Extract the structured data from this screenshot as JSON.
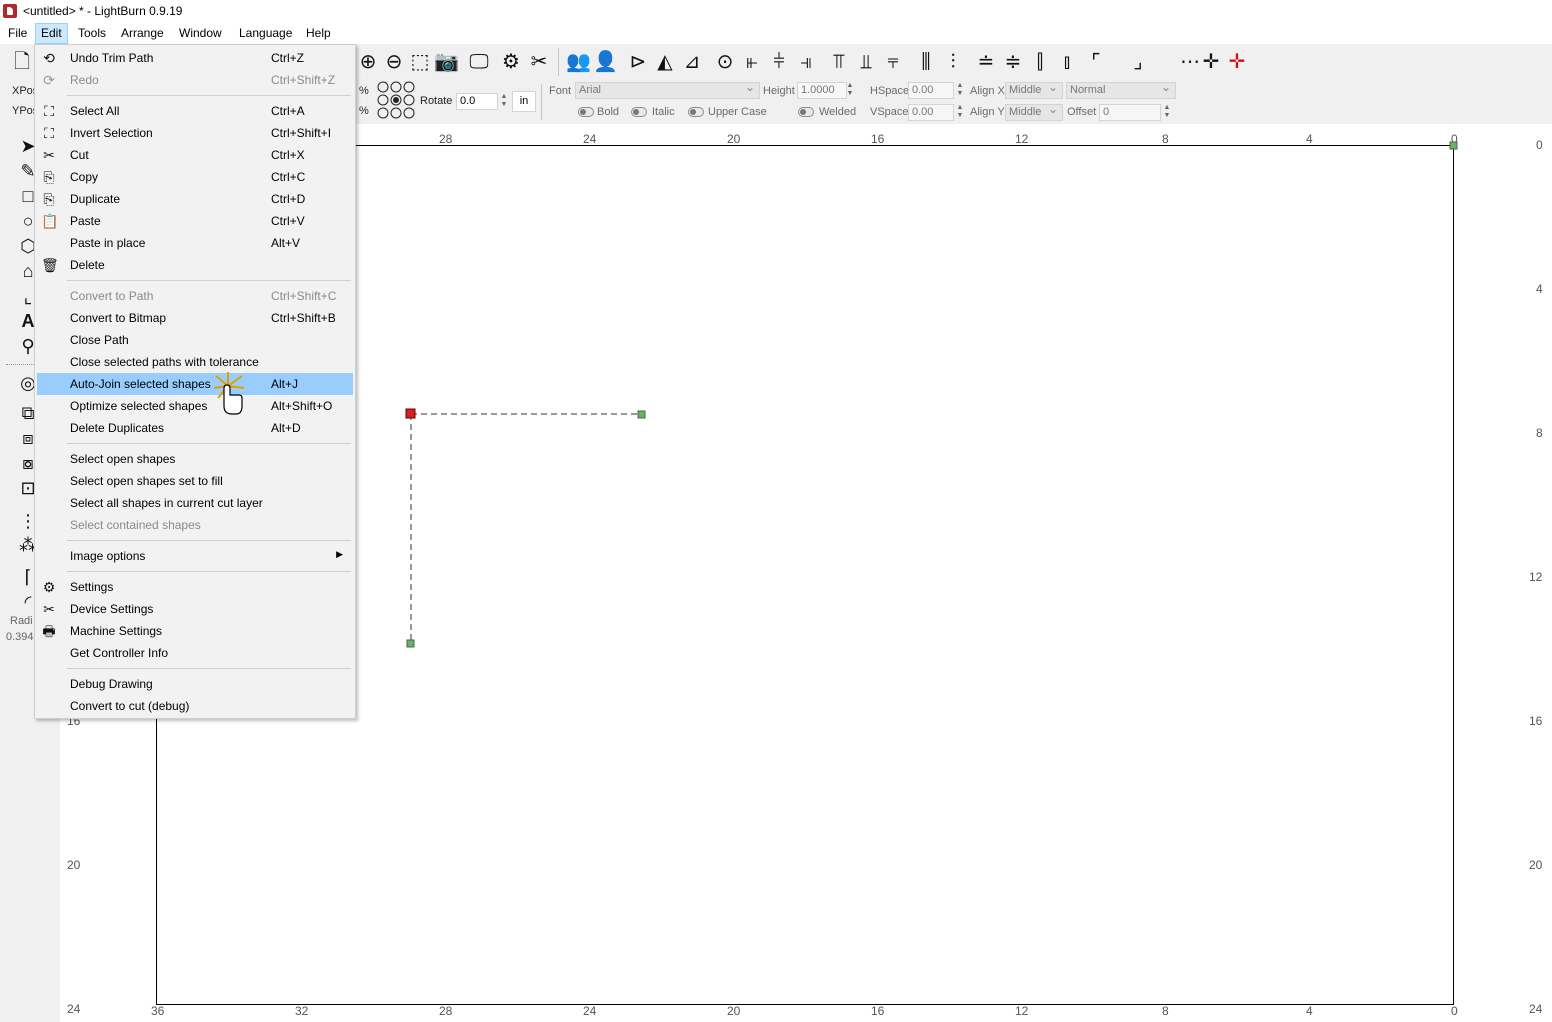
{
  "window": {
    "title": "<untitled> * - LightBurn 0.9.19"
  },
  "menubar": [
    "File",
    "Edit",
    "Tools",
    "Arrange",
    "Window",
    "Language",
    "Help"
  ],
  "edit_menu": {
    "items": [
      {
        "label": "Undo Trim Path",
        "shortcut": "Ctrl+Z",
        "icon": "undo-icon",
        "enabled": true
      },
      {
        "label": "Redo",
        "shortcut": "Ctrl+Shift+Z",
        "icon": "redo-icon",
        "enabled": false
      },
      {
        "label": "Select All",
        "shortcut": "Ctrl+A",
        "icon": "select-all-icon",
        "enabled": true
      },
      {
        "label": "Invert Selection",
        "shortcut": "Ctrl+Shift+I",
        "icon": "invert-selection-icon",
        "enabled": true
      },
      {
        "label": "Cut",
        "shortcut": "Ctrl+X",
        "icon": "scissors-icon",
        "enabled": true
      },
      {
        "label": "Copy",
        "shortcut": "Ctrl+C",
        "icon": "copy-icon",
        "enabled": true
      },
      {
        "label": "Duplicate",
        "shortcut": "Ctrl+D",
        "icon": "duplicate-icon",
        "enabled": true
      },
      {
        "label": "Paste",
        "shortcut": "Ctrl+V",
        "icon": "paste-icon",
        "enabled": true
      },
      {
        "label": "Paste in place",
        "shortcut": "Alt+V",
        "icon": "",
        "enabled": true
      },
      {
        "label": "Delete",
        "shortcut": "",
        "icon": "trash-icon",
        "enabled": true
      },
      {
        "label": "Convert to Path",
        "shortcut": "Ctrl+Shift+C",
        "icon": "",
        "enabled": false
      },
      {
        "label": "Convert to Bitmap",
        "shortcut": "Ctrl+Shift+B",
        "icon": "",
        "enabled": true
      },
      {
        "label": "Close Path",
        "shortcut": "",
        "icon": "",
        "enabled": true
      },
      {
        "label": "Close selected paths with tolerance",
        "shortcut": "",
        "icon": "",
        "enabled": true
      },
      {
        "label": "Auto-Join selected shapes",
        "shortcut": "Alt+J",
        "icon": "",
        "enabled": true,
        "highlighted": true
      },
      {
        "label": "Optimize selected shapes",
        "shortcut": "Alt+Shift+O",
        "icon": "",
        "enabled": true
      },
      {
        "label": "Delete Duplicates",
        "shortcut": "Alt+D",
        "icon": "",
        "enabled": true
      },
      {
        "label": "Select open shapes",
        "shortcut": "",
        "icon": "",
        "enabled": true
      },
      {
        "label": "Select open shapes set to fill",
        "shortcut": "",
        "icon": "",
        "enabled": true
      },
      {
        "label": "Select all shapes in current cut layer",
        "shortcut": "",
        "icon": "",
        "enabled": true
      },
      {
        "label": "Select contained shapes",
        "shortcut": "",
        "icon": "",
        "enabled": false
      },
      {
        "label": "Image options",
        "shortcut": "",
        "icon": "",
        "enabled": true,
        "submenu": true
      },
      {
        "label": "Settings",
        "shortcut": "",
        "icon": "gears-icon",
        "enabled": true
      },
      {
        "label": "Device Settings",
        "shortcut": "",
        "icon": "wrench-icon",
        "enabled": true
      },
      {
        "label": "Machine Settings",
        "shortcut": "",
        "icon": "machine-icon",
        "enabled": true
      },
      {
        "label": "Get Controller Info",
        "shortcut": "",
        "icon": "",
        "enabled": true
      },
      {
        "label": "Debug Drawing",
        "shortcut": "",
        "icon": "",
        "enabled": true
      },
      {
        "label": "Convert to cut (debug)",
        "shortcut": "",
        "icon": "",
        "enabled": true
      }
    ]
  },
  "props": {
    "xpos_label": "XPos",
    "ypos_label": "YPos",
    "pct1": "%",
    "pct2": "%",
    "rotate_label": "Rotate",
    "rotate_value": "0.0",
    "unit": "in",
    "font_label": "Font",
    "font_value": "Arial",
    "height_label": "Height",
    "height_value": "1.0000",
    "hspace_label": "HSpace",
    "hspace_value": "0.00",
    "vspace_label": "VSpace",
    "vspace_value": "0.00",
    "alignx_label": "Align X",
    "alignx_value": "Middle",
    "aligny_label": "Align Y",
    "aligny_value": "Middle",
    "style_value": "Normal",
    "offset_label": "Offset",
    "offset_value": "0",
    "bold_label": "Bold",
    "italic_label": "Italic",
    "upper_label": "Upper Case",
    "welded_label": "Welded"
  },
  "left_panel": {
    "radius_label": "Radi",
    "radius_value": "0.394"
  },
  "ruler": {
    "top": [
      "28",
      "24",
      "20",
      "16",
      "12",
      "8",
      "4",
      "0"
    ],
    "bottom": [
      "36",
      "32",
      "28",
      "24",
      "20",
      "16",
      "12",
      "8",
      "4",
      "0"
    ],
    "right": [
      "0",
      "4",
      "8",
      "12",
      "16",
      "20",
      "24"
    ],
    "left": [
      "16",
      "20",
      "24"
    ]
  },
  "colors": {
    "menu_highlight": "#99ccff",
    "start_node": "#d42020",
    "end_node": "#6fae6f"
  }
}
